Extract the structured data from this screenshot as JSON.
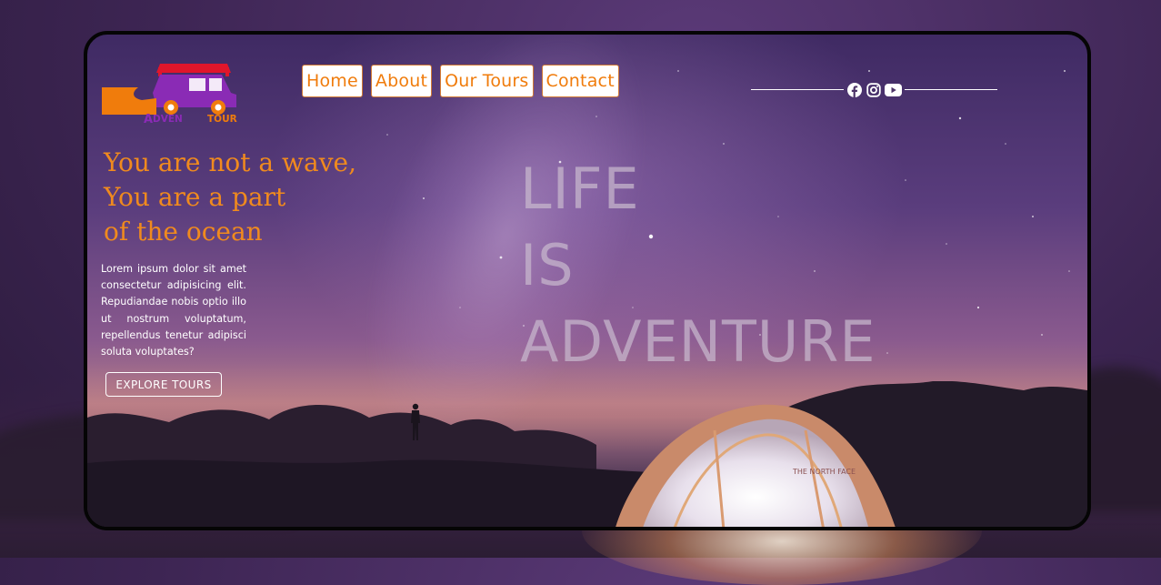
{
  "brand": {
    "logo_text_prefix": "A",
    "logo_text_mid": "DVEN",
    "logo_text_suffix": "TOUR",
    "colors": {
      "orange": "#f07c0c",
      "purple": "#8a2bb5",
      "red": "#e0162b"
    }
  },
  "nav": {
    "items": [
      {
        "label": "Home"
      },
      {
        "label": "About"
      },
      {
        "label": "Our Tours"
      },
      {
        "label": "Contact"
      }
    ]
  },
  "social": {
    "icons": [
      "facebook-icon",
      "instagram-icon",
      "youtube-icon"
    ]
  },
  "hero": {
    "tagline": [
      "You are not a wave,",
      "You are a part",
      "of the ocean"
    ],
    "description": "Lorem ipsum dolor sit amet consectetur adipisicing elit. Repudiandae nobis optio illo ut nostrum voluptatum, repellendus tenetur adipisci soluta voluptates?",
    "cta_label": "EXPLORE TOURS",
    "headline": [
      "LIFE",
      "IS",
      "ADVENTURE"
    ]
  },
  "tent": {
    "brand_text": "THE NORTH FACE"
  },
  "colors": {
    "accent": "#f08a1e",
    "text_light": "#ffffff",
    "headline": "#c8b9cd"
  }
}
